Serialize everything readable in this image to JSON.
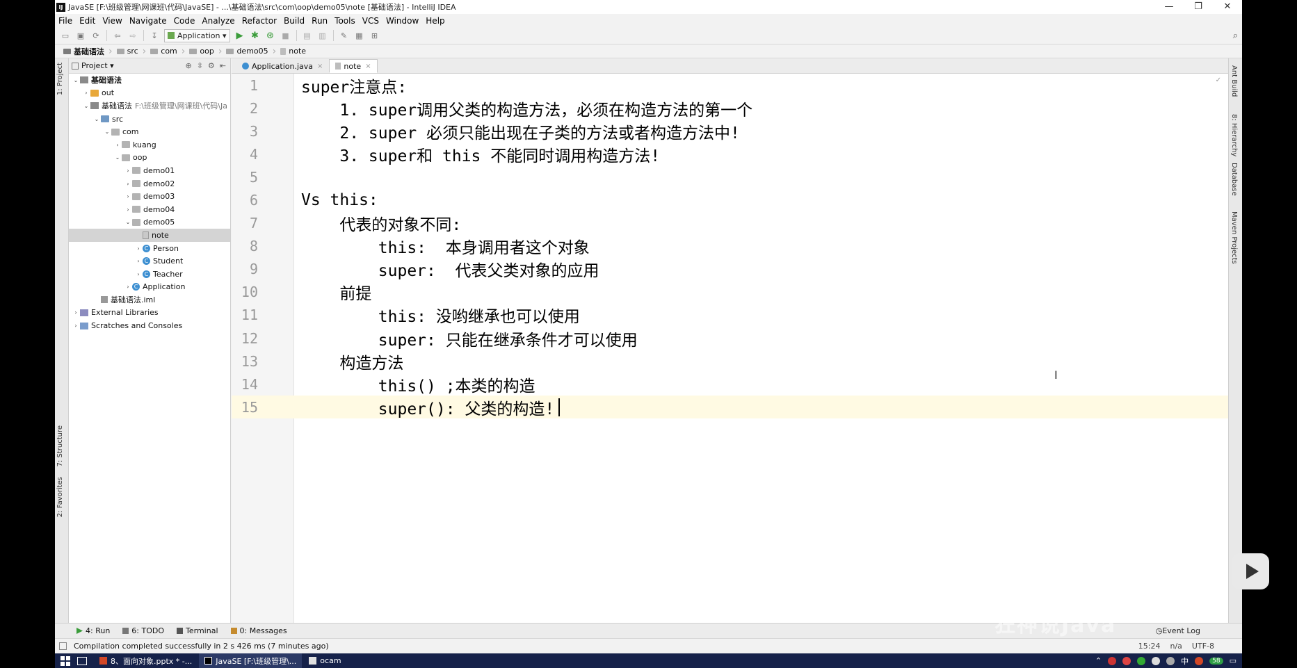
{
  "window": {
    "title": "JavaSE [F:\\班级管理\\网课班\\代码\\JavaSE] - ...\\基础语法\\src\\com\\oop\\demo05\\note [基础语法] - IntelliJ IDEA",
    "minimize": "—",
    "restore": "❐",
    "close": "✕"
  },
  "menu": [
    "File",
    "Edit",
    "View",
    "Navigate",
    "Code",
    "Analyze",
    "Refactor",
    "Build",
    "Run",
    "Tools",
    "VCS",
    "Window",
    "Help"
  ],
  "toolbar": {
    "run_config": "Application"
  },
  "breadcrumb": [
    "基础语法",
    "src",
    "com",
    "oop",
    "demo05",
    "note"
  ],
  "left_tabs": {
    "project": "1: Project",
    "structure": "7: Structure",
    "favorites": "2: Favorites"
  },
  "right_tabs": {
    "ant": "Ant Build",
    "hierarchy": "8: Hierarchy",
    "database": "Database",
    "maven": "Maven Projects"
  },
  "project": {
    "header": "Project",
    "tree": [
      {
        "label": "基础语法",
        "icon": "module-icon",
        "arrow": "⌄",
        "indent": 0
      },
      {
        "label": "out",
        "icon": "folder-icon",
        "arrow": "›",
        "indent": 1,
        "kind": "out"
      },
      {
        "label": "基础语法",
        "path": "F:\\班级管理\\网课班\\代码\\Ja",
        "icon": "module-icon",
        "arrow": "⌄",
        "indent": 1
      },
      {
        "label": "src",
        "icon": "folder-icon",
        "arrow": "⌄",
        "indent": 2,
        "kind": "src"
      },
      {
        "label": "com",
        "icon": "folder-icon",
        "arrow": "⌄",
        "indent": 3
      },
      {
        "label": "kuang",
        "icon": "folder-icon",
        "arrow": "›",
        "indent": 4
      },
      {
        "label": "oop",
        "icon": "folder-icon",
        "arrow": "⌄",
        "indent": 4
      },
      {
        "label": "demo01",
        "icon": "folder-icon",
        "arrow": "›",
        "indent": 5
      },
      {
        "label": "demo02",
        "icon": "folder-icon",
        "arrow": "›",
        "indent": 5
      },
      {
        "label": "demo03",
        "icon": "folder-icon",
        "arrow": "›",
        "indent": 5
      },
      {
        "label": "demo04",
        "icon": "folder-icon",
        "arrow": "›",
        "indent": 5
      },
      {
        "label": "demo05",
        "icon": "folder-icon",
        "arrow": "⌄",
        "indent": 5
      },
      {
        "label": "note",
        "icon": "note-icon",
        "arrow": "",
        "indent": 6,
        "selected": true
      },
      {
        "label": "Person",
        "icon": "class-icon",
        "arrow": "›",
        "indent": 6
      },
      {
        "label": "Student",
        "icon": "class-icon",
        "arrow": "›",
        "indent": 6
      },
      {
        "label": "Teacher",
        "icon": "class-icon",
        "arrow": "›",
        "indent": 6
      },
      {
        "label": "Application",
        "icon": "class-icon",
        "arrow": "›",
        "indent": 5
      },
      {
        "label": "基础语法.iml",
        "icon": "iml-icon",
        "arrow": "",
        "indent": 2
      },
      {
        "label": "External Libraries",
        "icon": "library-icon",
        "arrow": "›",
        "indent": 0
      },
      {
        "label": "Scratches and Consoles",
        "icon": "scratch-icon",
        "arrow": "›",
        "indent": 0
      }
    ]
  },
  "editor": {
    "tabs": [
      {
        "label": "Application.java",
        "close": "×",
        "active": false
      },
      {
        "label": "note",
        "close": "×",
        "active": true
      }
    ],
    "lines": [
      {
        "num": "1",
        "text": "super注意点:"
      },
      {
        "num": "2",
        "text": "    1. super调用父类的构造方法，必须在构造方法的第一个"
      },
      {
        "num": "3",
        "text": "    2. super 必须只能出现在子类的方法或者构造方法中!"
      },
      {
        "num": "4",
        "text": "    3. super和 this 不能同时调用构造方法!"
      },
      {
        "num": "5",
        "text": ""
      },
      {
        "num": "6",
        "text": "Vs this:"
      },
      {
        "num": "7",
        "text": "    代表的对象不同:"
      },
      {
        "num": "8",
        "text": "        this:  本身调用者这个对象"
      },
      {
        "num": "9",
        "text": "        super:  代表父类对象的应用"
      },
      {
        "num": "10",
        "text": "    前提"
      },
      {
        "num": "11",
        "text": "        this: 没哟继承也可以使用"
      },
      {
        "num": "12",
        "text": "        super: 只能在继承条件才可以使用"
      },
      {
        "num": "13",
        "text": "    构造方法"
      },
      {
        "num": "14",
        "text": "        this() ;本类的构造"
      },
      {
        "num": "15",
        "text": "        super(): 父类的构造!"
      }
    ]
  },
  "bottom_tools": [
    {
      "label": "4: Run",
      "icon": "run"
    },
    {
      "label": "6: TODO",
      "icon": "todo"
    },
    {
      "label": "Terminal",
      "icon": "term"
    },
    {
      "label": "0: Messages",
      "icon": "msg"
    }
  ],
  "event_log": "Event Log",
  "status": {
    "message": "Compilation completed successfully in 2 s 426 ms (7 minutes ago)",
    "position": "15:24",
    "na": "n/a",
    "encoding": "UTF-8"
  },
  "taskbar": {
    "tasks": [
      {
        "label": "8、面向对象.pptx * -...",
        "icon": "ppt"
      },
      {
        "label": "JavaSE [F:\\班级管理\\...",
        "icon": "ij",
        "active": true
      },
      {
        "label": "ocam",
        "icon": "oc"
      }
    ],
    "ime": "中",
    "badge": "58"
  },
  "watermark": "狂神说Java"
}
